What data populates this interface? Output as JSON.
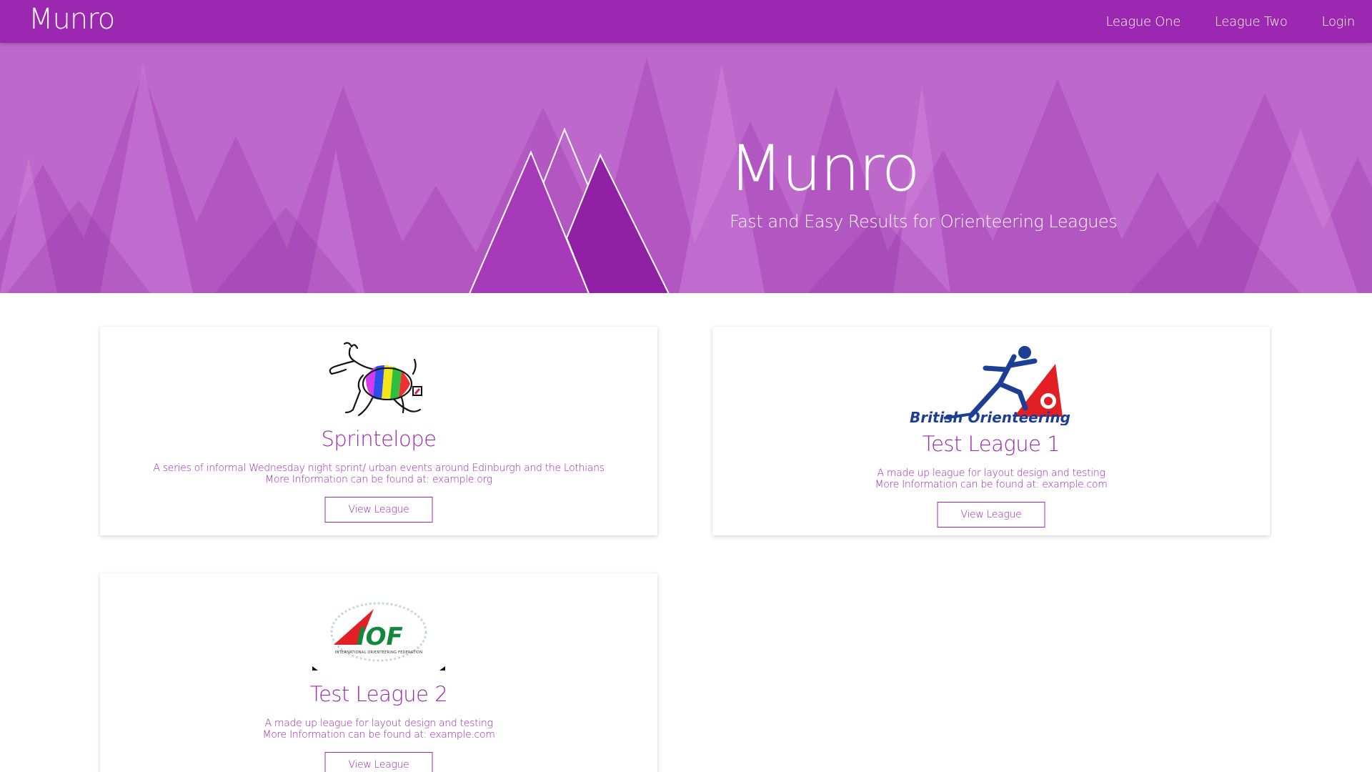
{
  "navbar": {
    "brand": "Munro",
    "links": [
      {
        "label": "League One"
      },
      {
        "label": "League Two"
      },
      {
        "label": "Login"
      }
    ],
    "color": "#9c27b0"
  },
  "hero": {
    "title": "Munro",
    "subtitle": "Fast and Easy Results for Orienteering Leagues",
    "logo_icon": "mountain-logo-icon",
    "background_color": "#bd68cb"
  },
  "leagues": [
    {
      "title": "Sprintelope",
      "description": "A series of informal Wednesday night sprint/ urban events around Edinburgh and the Lothians",
      "more_info": "More Information can be found at: example.org",
      "button": "View League",
      "logo_icon": "sprintelope-logo-icon"
    },
    {
      "title": "Test League 1",
      "description": "A made up league for layout design and testing",
      "more_info": "More Information can be found at: example.com",
      "button": "View League",
      "logo_icon": "british-orienteering-logo-icon",
      "logo_text": "British Orienteering"
    },
    {
      "title": "Test League 2",
      "description": "A made up league for layout design and testing",
      "more_info": "More Information can be found at: example.com",
      "button": "View League",
      "logo_icon": "iof-logo-icon",
      "logo_text": "IOF",
      "logo_subtext": "INTERNATIONAL ORIENTEERING FEDERATION"
    }
  ],
  "accent_color": "#9c27b0"
}
